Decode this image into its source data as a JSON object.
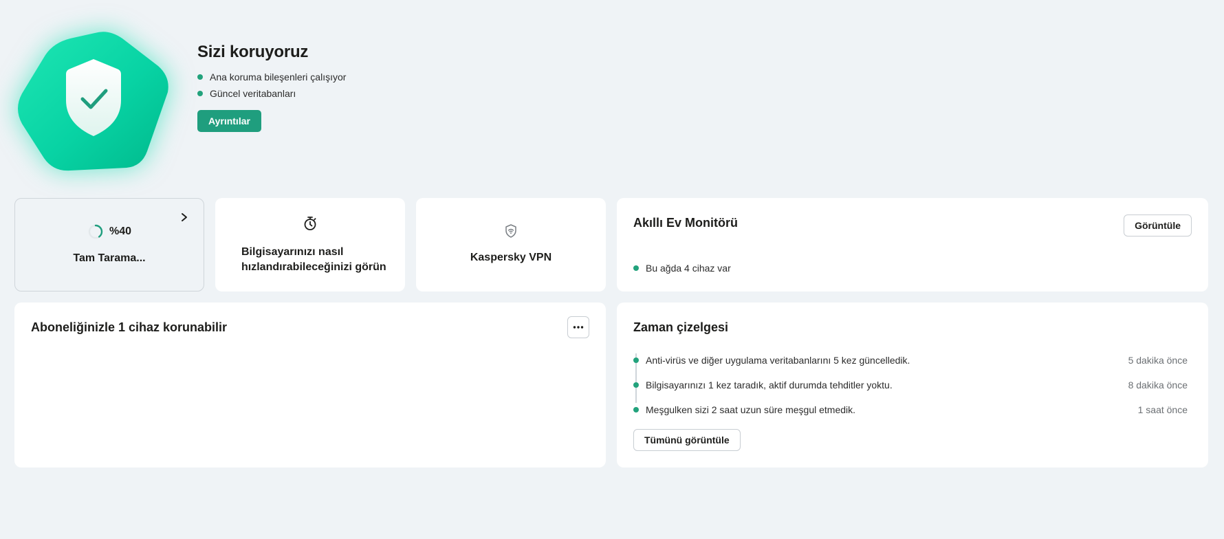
{
  "hero": {
    "title": "Sizi koruyoruz",
    "bullets": [
      "Ana koruma bileşenleri çalışıyor",
      "Güncel veritabanları"
    ],
    "details_button": "Ayrıntılar"
  },
  "scan_tile": {
    "percent": "%40",
    "progress": 0.4,
    "label": "Tam Tarama..."
  },
  "speed_tile": {
    "label": "Bilgisayarınızı nasıl hızlandırabileceğinizi görün"
  },
  "vpn_tile": {
    "label": "Kaspersky VPN"
  },
  "smart_home": {
    "title": "Akıllı Ev Monitörü",
    "view_button": "Görüntüle",
    "status": "Bu ağda 4 cihaz var"
  },
  "subscription": {
    "title": "Aboneliğinizle 1 cihaz korunabilir"
  },
  "timeline": {
    "title": "Zaman çizelgesi",
    "events": [
      {
        "text": "Anti-virüs ve diğer uygulama veritabanlarını 5 kez güncelledik.",
        "time": "5 dakika önce"
      },
      {
        "text": "Bilgisayarınızı 1 kez taradık, aktif durumda tehditler yoktu.",
        "time": "8 dakika önce"
      },
      {
        "text": "Meşgulken sizi 2 saat uzun süre meşgul etmedik.",
        "time": "1 saat önce"
      }
    ],
    "view_all_button": "Tümünü görüntüle"
  },
  "colors": {
    "accent": "#1f9e7e",
    "status_dot": "#22a27c",
    "background": "#eff3f6"
  },
  "icons": {
    "hero": "shield-check-icon",
    "scan": "progress-ring-icon",
    "speed": "stopwatch-icon",
    "vpn": "vpn-shield-wifi-icon",
    "more": "more-dots-icon",
    "chevron": "chevron-right-icon"
  }
}
